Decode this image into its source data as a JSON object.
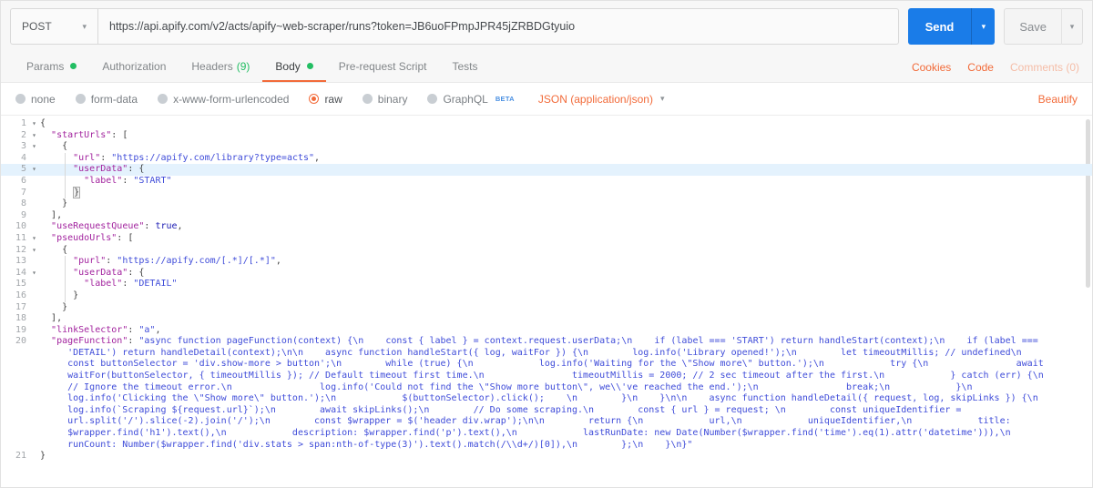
{
  "request_bar": {
    "method": "POST",
    "url": "https://api.apify.com/v2/acts/apify~web-scraper/runs?token=JB6uoFPmpJPR45jZRBDGtyuio",
    "send_label": "Send",
    "save_label": "Save"
  },
  "tabs": {
    "items": [
      {
        "label": "Params",
        "dot": true
      },
      {
        "label": "Authorization"
      },
      {
        "label": "Headers",
        "count": "(9)"
      },
      {
        "label": "Body",
        "dot": true,
        "active": true
      },
      {
        "label": "Pre-request Script"
      },
      {
        "label": "Tests"
      }
    ],
    "links": {
      "cookies": "Cookies",
      "code": "Code",
      "comments": "Comments (0)"
    }
  },
  "body_type": {
    "options": [
      {
        "label": "none"
      },
      {
        "label": "form-data"
      },
      {
        "label": "x-www-form-urlencoded"
      },
      {
        "label": "raw",
        "selected": true
      },
      {
        "label": "binary"
      },
      {
        "label": "GraphQL",
        "badge": "BETA"
      }
    ],
    "content_type": "JSON (application/json)",
    "beautify_label": "Beautify"
  },
  "colors": {
    "accent_orange": "#f26b3a",
    "green_dot": "#23be63",
    "send_blue": "#1a7ce8",
    "editor_key": "#a2239e",
    "editor_string": "#3f4cd9",
    "editor_atom": "#1b1bb3",
    "active_line_bg": "#e4f2fd"
  },
  "editor": {
    "lines": [
      {
        "num": 1,
        "fold": true,
        "tokens": [
          [
            "p",
            "{"
          ]
        ]
      },
      {
        "num": 2,
        "fold": true,
        "tokens": [
          [
            "p",
            "  "
          ],
          [
            "k",
            "\"startUrls\""
          ],
          [
            "p",
            ": ["
          ]
        ]
      },
      {
        "num": 3,
        "fold": true,
        "tokens": [
          [
            "p",
            "    {"
          ]
        ]
      },
      {
        "num": 4,
        "guide": true,
        "tokens": [
          [
            "p",
            "      "
          ],
          [
            "k",
            "\"url\""
          ],
          [
            "p",
            ": "
          ],
          [
            "s",
            "\"https://apify.com/library?type=acts\""
          ],
          [
            "p",
            ","
          ]
        ]
      },
      {
        "num": 5,
        "fold": true,
        "hl": true,
        "guide": true,
        "tokens": [
          [
            "p",
            "      "
          ],
          [
            "k",
            "\"userData\""
          ],
          [
            "p",
            ": {"
          ]
        ]
      },
      {
        "num": 6,
        "guide": true,
        "tokens": [
          [
            "p",
            "        "
          ],
          [
            "k",
            "\"label\""
          ],
          [
            "p",
            ": "
          ],
          [
            "s",
            "\"START\""
          ]
        ]
      },
      {
        "num": 7,
        "guide": true,
        "tokens": [
          [
            "p",
            "      "
          ],
          [
            "b",
            "}"
          ]
        ]
      },
      {
        "num": 8,
        "tokens": [
          [
            "p",
            "    }"
          ]
        ]
      },
      {
        "num": 9,
        "tokens": [
          [
            "p",
            "  ],"
          ]
        ]
      },
      {
        "num": 10,
        "tokens": [
          [
            "p",
            "  "
          ],
          [
            "k",
            "\"useRequestQueue\""
          ],
          [
            "p",
            ": "
          ],
          [
            "a",
            "true"
          ],
          [
            "p",
            ","
          ]
        ]
      },
      {
        "num": 11,
        "fold": true,
        "tokens": [
          [
            "p",
            "  "
          ],
          [
            "k",
            "\"pseudoUrls\""
          ],
          [
            "p",
            ": ["
          ]
        ]
      },
      {
        "num": 12,
        "fold": true,
        "tokens": [
          [
            "p",
            "    {"
          ]
        ]
      },
      {
        "num": 13,
        "guide": true,
        "tokens": [
          [
            "p",
            "      "
          ],
          [
            "k",
            "\"purl\""
          ],
          [
            "p",
            ": "
          ],
          [
            "s",
            "\"https://apify.com/[.*]/[.*]\""
          ],
          [
            "p",
            ","
          ]
        ]
      },
      {
        "num": 14,
        "fold": true,
        "guide": true,
        "tokens": [
          [
            "p",
            "      "
          ],
          [
            "k",
            "\"userData\""
          ],
          [
            "p",
            ": {"
          ]
        ]
      },
      {
        "num": 15,
        "guide": true,
        "tokens": [
          [
            "p",
            "        "
          ],
          [
            "k",
            "\"label\""
          ],
          [
            "p",
            ": "
          ],
          [
            "s",
            "\"DETAIL\""
          ]
        ]
      },
      {
        "num": 16,
        "guide": true,
        "tokens": [
          [
            "p",
            "      }"
          ]
        ]
      },
      {
        "num": 17,
        "tokens": [
          [
            "p",
            "    }"
          ]
        ]
      },
      {
        "num": 18,
        "tokens": [
          [
            "p",
            "  ],"
          ]
        ]
      },
      {
        "num": 19,
        "tokens": [
          [
            "p",
            "  "
          ],
          [
            "k",
            "\"linkSelector\""
          ],
          [
            "p",
            ": "
          ],
          [
            "s",
            "\"a\""
          ],
          [
            "p",
            ","
          ]
        ]
      },
      {
        "num": 20,
        "tokens": [
          [
            "p",
            "  "
          ],
          [
            "k",
            "\"pageFunction\""
          ],
          [
            "p",
            ": "
          ],
          [
            "s",
            "\"async function pageFunction(context) {\\n    const { label } = context.request.userData;\\n    if (label === 'START') return handleStart(context);\\n    if (label === 'DETAIL') return handleDetail(context);\\n\\n    async function handleStart({ log, waitFor }) {\\n        log.info('Library opened!');\\n        let timeoutMillis; // undefined\\n        const buttonSelector = 'div.show-more > button';\\n        while (true) {\\n            log.info('Waiting for the \\\"Show more\\\" button.');\\n            try {\\n                await waitFor(buttonSelector, { timeoutMillis }); // Default timeout first time.\\n                timeoutMillis = 2000; // 2 sec timeout after the first.\\n            } catch (err) {\\n                // Ignore the timeout error.\\n                log.info('Could not find the \\\"Show more button\\\", we\\\\'ve reached the end.');\\n                break;\\n            }\\n            log.info('Clicking the \\\"Show more\\\" button.');\\n            $(buttonSelector).click();    \\n        }\\n    }\\n\\n    async function handleDetail({ request, log, skipLinks }) {\\n        log.info(`Scraping ${request.url}`);\\n        await skipLinks();\\n        // Do some scraping.\\n        const { url } = request; \\n        const uniqueIdentifier = url.split('/').slice(-2).join('/');\\n        const $wrapper = $('header div.wrap');\\n\\n        return {\\n            url,\\n            uniqueIdentifier,\\n            title: $wrapper.find('h1').text(),\\n            description: $wrapper.find('p').text(),\\n            lastRunDate: new Date(Number($wrapper.find('time').eq(1).attr('datetime'))),\\n            runCount: Number($wrapper.find('div.stats > span:nth-of-type(3)').text().match(/\\\\d+/)[0]),\\n        };\\n    }\\n}\""
          ]
        ]
      },
      {
        "num": 21,
        "tokens": [
          [
            "p",
            "}"
          ]
        ]
      }
    ]
  }
}
